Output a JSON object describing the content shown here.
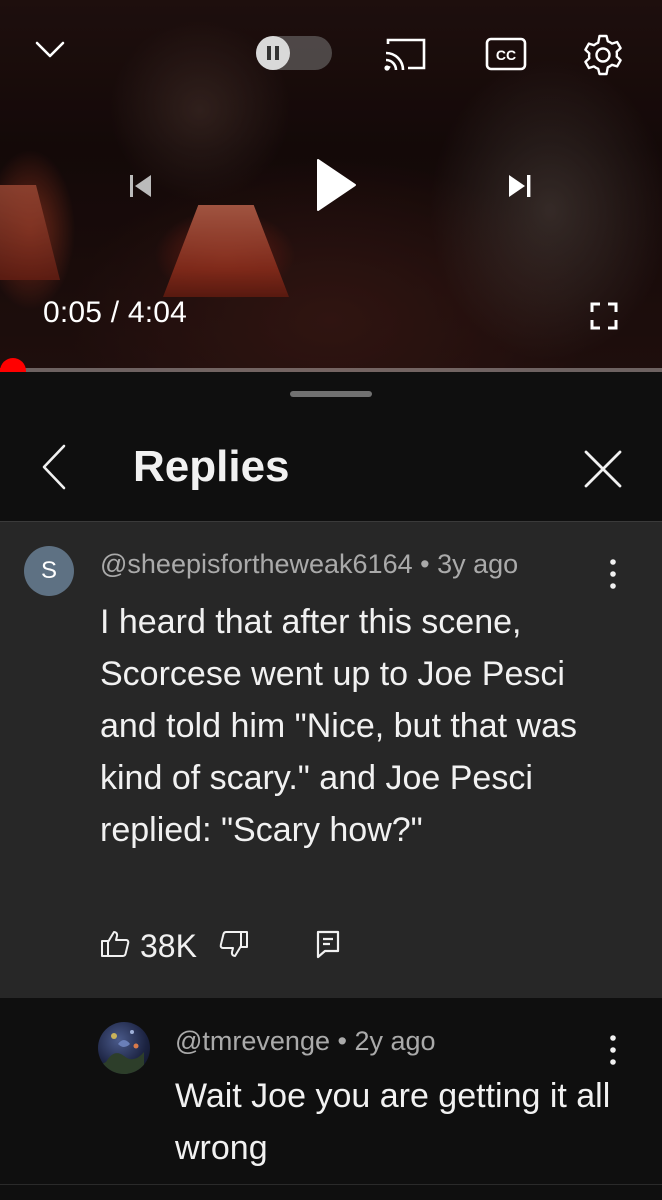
{
  "player": {
    "current_time": "0:05",
    "separator": "/",
    "duration": "4:04",
    "progress_fraction": 0.02,
    "icons": [
      "chevron-down-icon",
      "pause-icon",
      "cast-icon",
      "captions-icon",
      "settings-icon",
      "previous-icon",
      "play-icon",
      "next-icon",
      "fullscreen-icon"
    ],
    "captions_label": "CC"
  },
  "panel": {
    "title": "Replies",
    "back_icon": "chevron-left-icon",
    "close_icon": "close-icon"
  },
  "parent_comment": {
    "avatar_letter": "S",
    "author": "@sheepisfortheweak6164",
    "dot": "•",
    "age": "3y ago",
    "text": "I heard that after this scene, Scorcese went up to Joe Pesci and told him \"Nice, but that was kind of scary.\" and Joe Pesci replied: \"Scary how?\"",
    "like_count": "38K",
    "icons": [
      "thumbs-up-icon",
      "thumbs-down-icon",
      "reply-icon",
      "more-vert-icon"
    ]
  },
  "reply": {
    "author": "@tmrevenge",
    "dot": "•",
    "age": "2y ago",
    "text": "Wait Joe you are getting it all wrong"
  },
  "colors": {
    "accent_red": "#ff0000",
    "panel_bg": "#0f0f0f",
    "comment_bg": "#272727",
    "secondary_text": "#aaaaaa"
  }
}
